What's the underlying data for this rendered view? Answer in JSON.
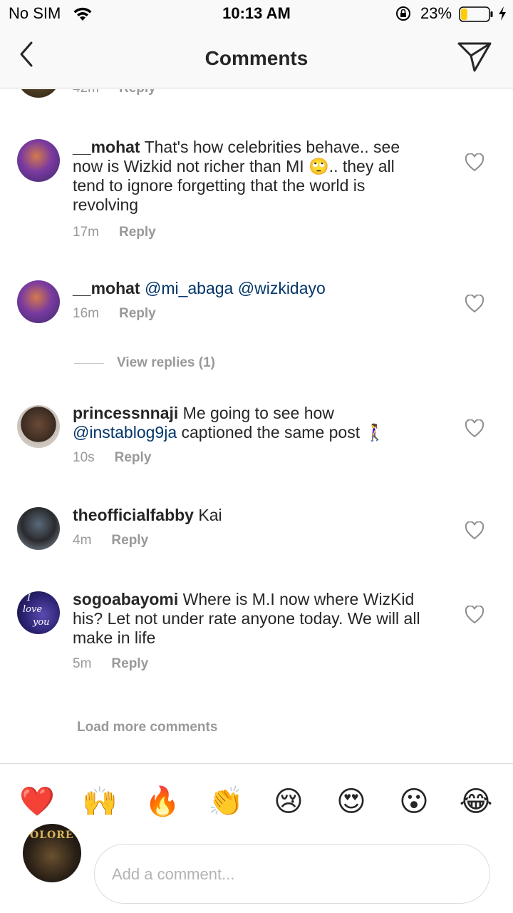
{
  "status_bar": {
    "carrier": "No SIM",
    "time": "10:13 AM",
    "battery_percent": "23%",
    "battery_level": 0.23,
    "battery_color": "#ffcc00"
  },
  "nav": {
    "title": "Comments",
    "back_icon": "chevron-left-icon",
    "send_icon": "paper-plane-icon"
  },
  "partial_top": {
    "time": "42m",
    "reply": "Reply"
  },
  "comments": [
    {
      "username": "__mohat",
      "text_before": "That's how celebrities behave.. see now is Wizkid not richer than MI",
      "emoji": "🙄",
      "text_after": ".. they all tend to ignore forgetting that the world is revolving",
      "time": "17m",
      "reply": "Reply"
    },
    {
      "username": "__mohat",
      "mention1": "@mi_abaga",
      "mention2": "@wizkidayo",
      "time": "16m",
      "reply": "Reply"
    },
    {
      "username": "princessnnaji",
      "text_before": "Me going to see how",
      "mention": "@instablog9ja",
      "text_after": "captioned the same post",
      "emoji": "🚶‍♀️",
      "time": "10s",
      "reply": "Reply"
    },
    {
      "username": "theofficialfabby",
      "text": "Kai",
      "time": "4m",
      "reply": "Reply"
    },
    {
      "username": "sogoabayomi",
      "text": "Where is M.I now where WizKid his? Let not under rate anyone today. We will all make in life",
      "avatar_text_1": "I",
      "avatar_text_2": "love",
      "avatar_text_3": "you",
      "time": "5m",
      "reply": "Reply"
    }
  ],
  "view_replies": "View replies (1)",
  "load_more": "Load more comments",
  "quick_reactions": [
    "❤️",
    "🙌",
    "🔥",
    "👏",
    "😢",
    "😍",
    "😮",
    "😂"
  ],
  "compose": {
    "placeholder": "Add a comment...",
    "avatar_text": "OLORE"
  },
  "colors": {
    "mention": "#003569",
    "meta": "#999999",
    "text": "#262626"
  }
}
